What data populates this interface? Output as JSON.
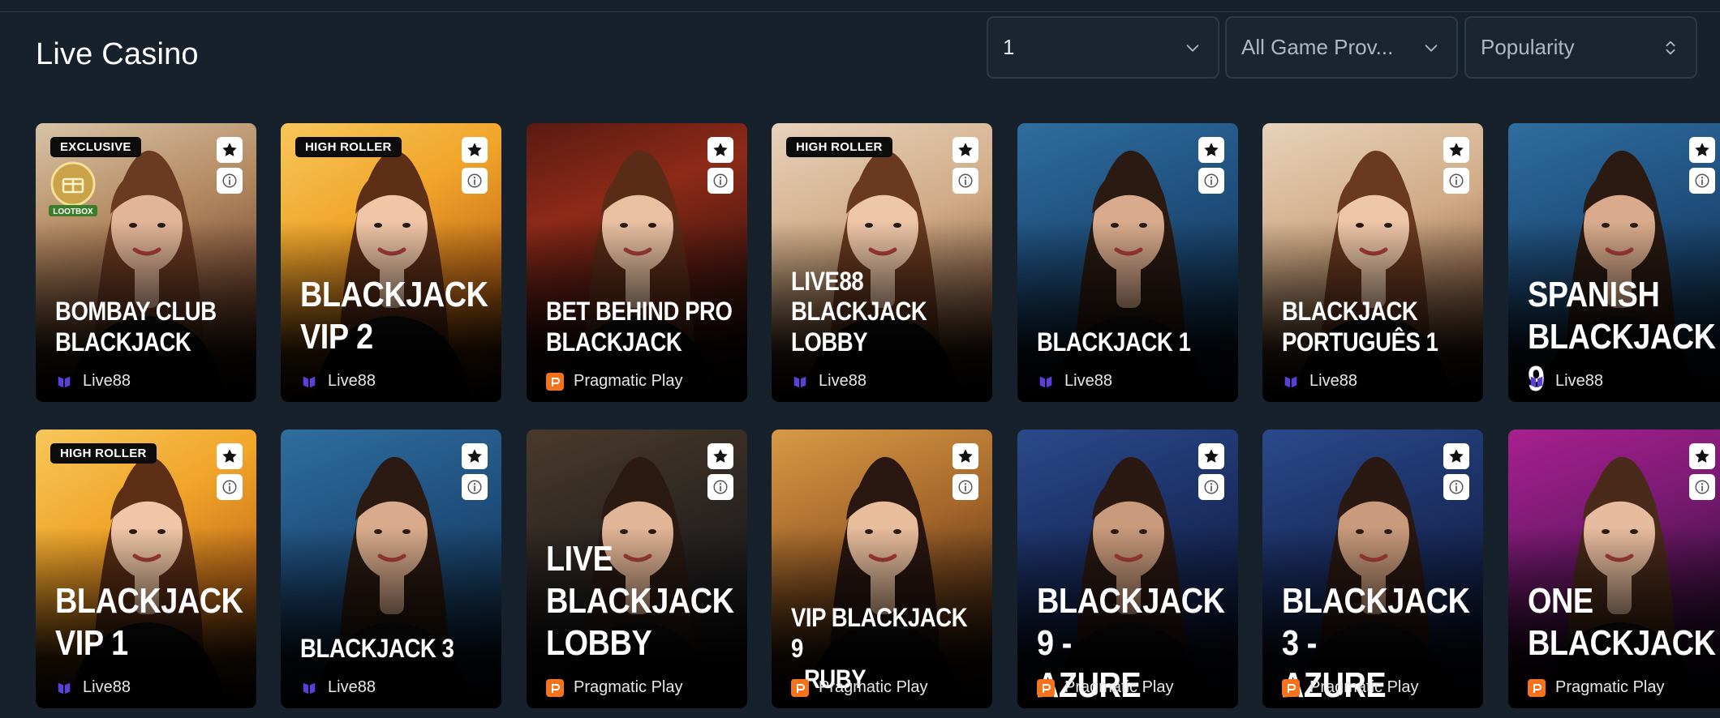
{
  "page": {
    "title": "Live Casino"
  },
  "filters": {
    "count_value": "1",
    "provider_value": "All Game Prov...",
    "sort_value": "Popularity"
  },
  "colors": {
    "background": "#17212b",
    "pragmatic": "#f5731c",
    "live88": "#5b3fd6"
  },
  "games": [
    {
      "title_lines": [
        "BOMBAY CLUB",
        "BLACKJACK"
      ],
      "provider": "Live88",
      "badge": "EXCLUSIVE",
      "lootbox": "LOOTBOX",
      "theme": "bombay",
      "size": "md"
    },
    {
      "title_lines": [
        "BLACKJACK",
        "VIP 2"
      ],
      "provider": "Live88",
      "badge": "HIGH ROLLER",
      "theme": "gold",
      "size": "lg"
    },
    {
      "title_lines": [
        "BET BEHIND PRO",
        "BLACKJACK"
      ],
      "provider": "Pragmatic Play",
      "badge": "",
      "theme": "red",
      "size": "md"
    },
    {
      "title_lines": [
        "LIVE88",
        "BLACKJACK",
        "LOBBY"
      ],
      "provider": "Live88",
      "badge": "HIGH ROLLER",
      "theme": "cream",
      "size": "md"
    },
    {
      "title_lines": [
        "BLACKJACK 1"
      ],
      "provider": "Live88",
      "badge": "",
      "theme": "blue",
      "size": "md"
    },
    {
      "title_lines": [
        "BLACKJACK",
        "PORTUGUÊS 1"
      ],
      "provider": "Live88",
      "badge": "",
      "theme": "cream",
      "size": "md"
    },
    {
      "title_lines": [
        "SPANISH",
        "BLACKJACK 9"
      ],
      "provider": "Live88",
      "badge": "",
      "theme": "blue",
      "size": "lg"
    },
    {
      "title_lines": [
        "BLACKJACK",
        "VIP 1"
      ],
      "provider": "Live88",
      "badge": "HIGH ROLLER",
      "theme": "gold",
      "size": "lg"
    },
    {
      "title_lines": [
        "BLACKJACK 3"
      ],
      "provider": "Live88",
      "badge": "",
      "theme": "blue",
      "size": "md"
    },
    {
      "title_lines": [
        "LIVE",
        "BLACKJACK",
        "LOBBY"
      ],
      "provider": "Pragmatic Play",
      "badge": "",
      "theme": "dark",
      "size": "lg"
    },
    {
      "title_lines": [
        "VIP BLACKJACK 9",
        "- RUBY"
      ],
      "provider": "Pragmatic Play",
      "badge": "",
      "theme": "amber",
      "size": "md"
    },
    {
      "title_lines": [
        "BLACKJACK 9 -",
        "AZURE"
      ],
      "provider": "Pragmatic Play",
      "badge": "",
      "theme": "navy",
      "size": "lg"
    },
    {
      "title_lines": [
        "BLACKJACK 3 -",
        "AZURE"
      ],
      "provider": "Pragmatic Play",
      "badge": "",
      "theme": "navy",
      "size": "lg"
    },
    {
      "title_lines": [
        "ONE",
        "BLACKJACK"
      ],
      "provider": "Pragmatic Play",
      "badge": "",
      "theme": "purple",
      "size": "lg"
    }
  ]
}
